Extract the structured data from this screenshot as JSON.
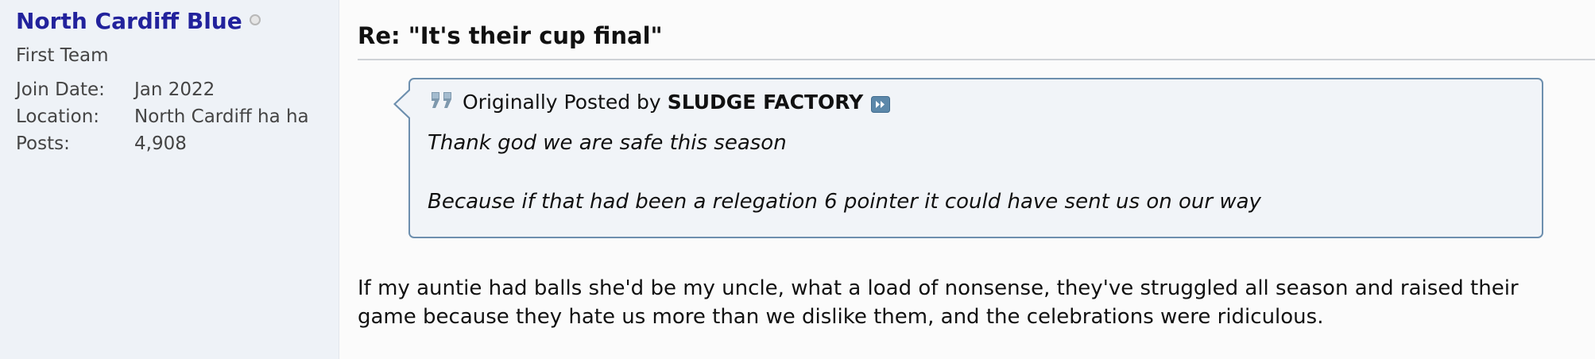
{
  "user": {
    "name": "North Cardiff Blue",
    "title": "First Team",
    "stats": [
      {
        "label": "Join Date:",
        "value": "Jan 2022"
      },
      {
        "label": "Location:",
        "value": "North Cardiff ha ha"
      },
      {
        "label": "Posts:",
        "value": "4,908"
      }
    ]
  },
  "post": {
    "title": "Re: \"It's their cup final\"",
    "quote": {
      "prefix": "Originally Posted by",
      "author": "SLUDGE FACTORY",
      "lines": [
        "Thank god we are safe this season",
        "Because if that had been a relegation 6 pointer it could have sent us on our way"
      ]
    },
    "body": "If my auntie had balls she'd be my uncle, what a load of nonsense, they've struggled all season and raised their game because they hate us more than we dislike them, and the celebrations were ridiculous."
  },
  "colors": {
    "username": "#22229c",
    "sidebar_bg": "#eef2f7",
    "quote_border": "#6d8fae",
    "quote_bg": "#f1f4f8"
  },
  "icons": {
    "status": "offline-status-icon",
    "quote": "quote-marks-icon",
    "view_post": "view-post-icon"
  }
}
